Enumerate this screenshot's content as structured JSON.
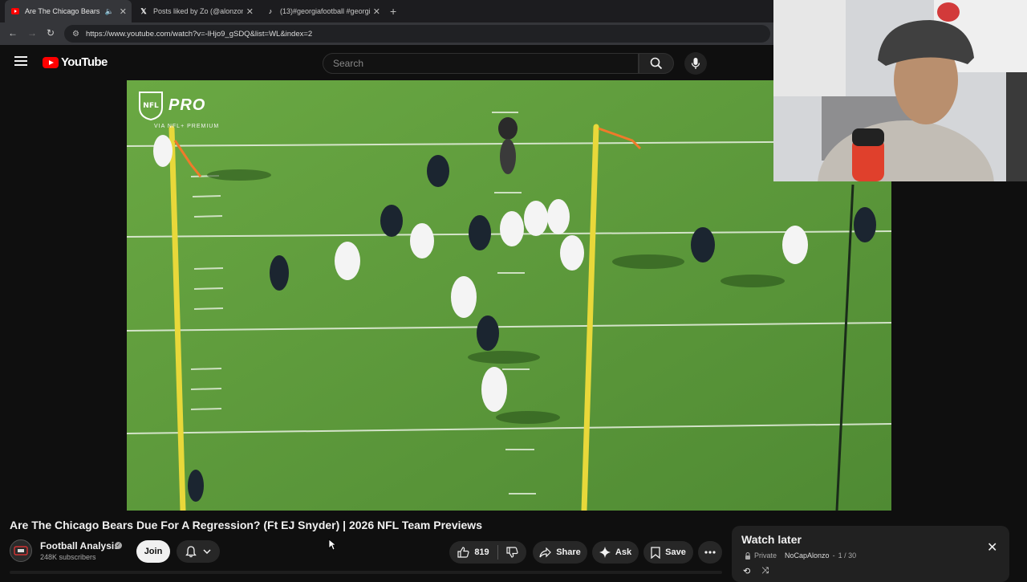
{
  "browser": {
    "tabs": [
      {
        "label": "Are The Chicago Bears Due",
        "active": true
      },
      {
        "label": "Posts liked by Zo (@alonzonem",
        "active": false
      },
      {
        "label": "(13)#georgiafootball #georgia",
        "active": false
      }
    ],
    "url": "https://www.youtube.com/watch?v=-lHjo9_gSDQ&list=WL&index=2"
  },
  "header": {
    "logo_text": "YouTube",
    "search_placeholder": "Search"
  },
  "video": {
    "overlay_brand": "PRO",
    "overlay_sub": "VIA NFL+ PREMIUM",
    "title": "Are The Chicago Bears Due For A Regression? (Ft EJ Snyder) | 2026 NFL Team Previews"
  },
  "channel": {
    "name": "Football Analysis",
    "subscribers": "248K subscribers",
    "join_label": "Join"
  },
  "actions": {
    "likes": "819",
    "share_label": "Share",
    "ask_label": "Ask",
    "save_label": "Save"
  },
  "watch_later": {
    "title": "Watch later",
    "privacy": "Private",
    "owner": "NoCapAlonzo",
    "position": "1 / 30"
  },
  "colors": {
    "youtube_red": "#ff0000",
    "background": "#0f0f0f",
    "field_green": "#5e9a3b",
    "goalpost_yellow": "#e8d83a"
  }
}
